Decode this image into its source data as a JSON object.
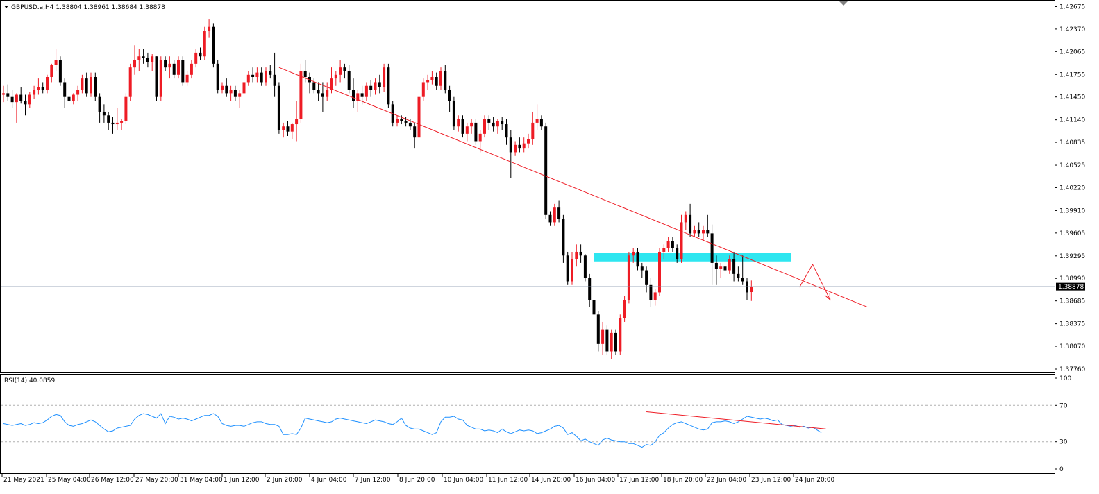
{
  "header": {
    "symbol_info": "GBPUSD.a,H4  1.38804 1.38961 1.38684 1.38878",
    "rsi_info": "RSI(14) 40.0859"
  },
  "current_price_label": "1.38878",
  "chart_data": {
    "type": "candlestick",
    "symbol": "GBPUSD.a",
    "timeframe": "H4",
    "ohlc_current": {
      "open": 1.38804,
      "high": 1.38961,
      "low": 1.38684,
      "close": 1.38878
    },
    "price_axis": {
      "ylim": [
        1.3776,
        1.4267
      ],
      "ticks": [
        "1.42675",
        "1.42370",
        "1.42065",
        "1.41755",
        "1.41450",
        "1.41140",
        "1.40835",
        "1.40525",
        "1.40220",
        "1.39910",
        "1.39605",
        "1.39295",
        "1.38990",
        "1.38685",
        "1.38375",
        "1.38070",
        "1.37760"
      ]
    },
    "x_ticks": [
      "21 May 2021",
      "25 May 04:00",
      "26 May 12:00",
      "27 May 20:00",
      "31 May 04:00",
      "1 Jun 12:00",
      "2 Jun 20:00",
      "4 Jun 04:00",
      "7 Jun 12:00",
      "8 Jun 20:00",
      "10 Jun 04:00",
      "11 Jun 12:00",
      "14 Jun 20:00",
      "16 Jun 04:00",
      "17 Jun 12:00",
      "18 Jun 20:00",
      "22 Jun 04:00",
      "23 Jun 12:00",
      "24 Jun 20:00"
    ],
    "candles": [
      [
        1.4148,
        1.416,
        1.4138,
        1.415
      ],
      [
        1.415,
        1.4162,
        1.414,
        1.4145
      ],
      [
        1.4145,
        1.4155,
        1.413,
        1.4138
      ],
      [
        1.4138,
        1.415,
        1.411,
        1.4148
      ],
      [
        1.4148,
        1.4158,
        1.4136,
        1.414
      ],
      [
        1.414,
        1.4148,
        1.412,
        1.4135
      ],
      [
        1.4135,
        1.4152,
        1.413,
        1.4148
      ],
      [
        1.4148,
        1.416,
        1.4142,
        1.4155
      ],
      [
        1.4155,
        1.417,
        1.4148,
        1.4158
      ],
      [
        1.4158,
        1.4165,
        1.415,
        1.4155
      ],
      [
        1.4155,
        1.4175,
        1.415,
        1.4172
      ],
      [
        1.4172,
        1.419,
        1.4165,
        1.4188
      ],
      [
        1.4188,
        1.421,
        1.418,
        1.4195
      ],
      [
        1.4195,
        1.42,
        1.416,
        1.4165
      ],
      [
        1.4165,
        1.417,
        1.413,
        1.4145
      ],
      [
        1.4145,
        1.4152,
        1.413,
        1.414
      ],
      [
        1.414,
        1.415,
        1.4135,
        1.4148
      ],
      [
        1.4148,
        1.416,
        1.414,
        1.4155
      ],
      [
        1.4155,
        1.4175,
        1.415,
        1.417
      ],
      [
        1.417,
        1.4178,
        1.4145,
        1.415
      ],
      [
        1.415,
        1.4178,
        1.4145,
        1.4172
      ],
      [
        1.4172,
        1.4178,
        1.414,
        1.4145
      ],
      [
        1.4145,
        1.415,
        1.411,
        1.4125
      ],
      [
        1.4125,
        1.4135,
        1.411,
        1.412
      ],
      [
        1.412,
        1.4125,
        1.41,
        1.411
      ],
      [
        1.411,
        1.4118,
        1.4095,
        1.4108
      ],
      [
        1.4108,
        1.413,
        1.41,
        1.411
      ],
      [
        1.411,
        1.4115,
        1.41,
        1.4112
      ],
      [
        1.4112,
        1.415,
        1.4108,
        1.4145
      ],
      [
        1.4145,
        1.419,
        1.414,
        1.4185
      ],
      [
        1.4185,
        1.4215,
        1.4175,
        1.4195
      ],
      [
        1.4195,
        1.421,
        1.418,
        1.42
      ],
      [
        1.42,
        1.421,
        1.419,
        1.4198
      ],
      [
        1.4198,
        1.4205,
        1.4185,
        1.4192
      ],
      [
        1.4192,
        1.4203,
        1.418,
        1.42
      ],
      [
        1.42,
        1.42,
        1.414,
        1.4145
      ],
      [
        1.4145,
        1.42,
        1.414,
        1.4195
      ],
      [
        1.4195,
        1.42,
        1.418,
        1.4185
      ],
      [
        1.4185,
        1.42,
        1.417,
        1.419
      ],
      [
        1.419,
        1.4195,
        1.417,
        1.4175
      ],
      [
        1.4175,
        1.42,
        1.417,
        1.4195
      ],
      [
        1.4195,
        1.42,
        1.416,
        1.4165
      ],
      [
        1.4165,
        1.418,
        1.416,
        1.4175
      ],
      [
        1.4175,
        1.4195,
        1.417,
        1.419
      ],
      [
        1.419,
        1.421,
        1.4185,
        1.4205
      ],
      [
        1.4205,
        1.4212,
        1.4195,
        1.42
      ],
      [
        1.42,
        1.424,
        1.4195,
        1.4235
      ],
      [
        1.4235,
        1.425,
        1.4225,
        1.424
      ],
      [
        1.424,
        1.4245,
        1.4185,
        1.419
      ],
      [
        1.419,
        1.4195,
        1.415,
        1.4155
      ],
      [
        1.4155,
        1.4165,
        1.415,
        1.416
      ],
      [
        1.416,
        1.417,
        1.4145,
        1.415
      ],
      [
        1.415,
        1.416,
        1.414,
        1.4155
      ],
      [
        1.4155,
        1.416,
        1.414,
        1.4145
      ],
      [
        1.4145,
        1.4155,
        1.413,
        1.415
      ],
      [
        1.415,
        1.4168,
        1.4112,
        1.4165
      ],
      [
        1.4165,
        1.418,
        1.416,
        1.4175
      ],
      [
        1.4175,
        1.4185,
        1.4165,
        1.4172
      ],
      [
        1.4172,
        1.4185,
        1.4165,
        1.4178
      ],
      [
        1.4178,
        1.4185,
        1.416,
        1.4165
      ],
      [
        1.4165,
        1.4185,
        1.416,
        1.418
      ],
      [
        1.418,
        1.4188,
        1.417,
        1.4175
      ],
      [
        1.4175,
        1.4205,
        1.4145,
        1.416
      ],
      [
        1.416,
        1.4165,
        1.4095,
        1.41
      ],
      [
        1.41,
        1.411,
        1.409,
        1.4105
      ],
      [
        1.4105,
        1.4112,
        1.4092,
        1.4098
      ],
      [
        1.4098,
        1.411,
        1.4088,
        1.4108
      ],
      [
        1.4108,
        1.414,
        1.4085,
        1.4115
      ],
      [
        1.4115,
        1.419,
        1.411,
        1.418
      ],
      [
        1.418,
        1.4195,
        1.4165,
        1.4172
      ],
      [
        1.4172,
        1.4178,
        1.415,
        1.4165
      ],
      [
        1.4165,
        1.417,
        1.415,
        1.4155
      ],
      [
        1.4155,
        1.4165,
        1.414,
        1.415
      ],
      [
        1.415,
        1.4165,
        1.4125,
        1.4145
      ],
      [
        1.4145,
        1.4165,
        1.414,
        1.4155
      ],
      [
        1.4155,
        1.4185,
        1.415,
        1.417
      ],
      [
        1.417,
        1.418,
        1.416,
        1.4175
      ],
      [
        1.4175,
        1.4195,
        1.4165,
        1.4185
      ],
      [
        1.4185,
        1.419,
        1.417,
        1.418
      ],
      [
        1.418,
        1.4188,
        1.415,
        1.4155
      ],
      [
        1.4155,
        1.417,
        1.413,
        1.414
      ],
      [
        1.414,
        1.4155,
        1.4125,
        1.415
      ],
      [
        1.415,
        1.416,
        1.4135,
        1.4145
      ],
      [
        1.4145,
        1.4165,
        1.414,
        1.416
      ],
      [
        1.416,
        1.4168,
        1.4145,
        1.4155
      ],
      [
        1.4155,
        1.417,
        1.4148,
        1.4165
      ],
      [
        1.4165,
        1.4175,
        1.415,
        1.4158
      ],
      [
        1.4158,
        1.419,
        1.4152,
        1.4185
      ],
      [
        1.4185,
        1.419,
        1.413,
        1.4135
      ],
      [
        1.4135,
        1.414,
        1.4105,
        1.411
      ],
      [
        1.411,
        1.412,
        1.4105,
        1.4115
      ],
      [
        1.4115,
        1.412,
        1.4108,
        1.4112
      ],
      [
        1.4112,
        1.4118,
        1.4105,
        1.411
      ],
      [
        1.411,
        1.4115,
        1.41,
        1.4105
      ],
      [
        1.4105,
        1.411,
        1.4075,
        1.409
      ],
      [
        1.409,
        1.415,
        1.4085,
        1.4145
      ],
      [
        1.4145,
        1.417,
        1.414,
        1.4165
      ],
      [
        1.4165,
        1.4175,
        1.4155,
        1.4168
      ],
      [
        1.4168,
        1.418,
        1.4162,
        1.4172
      ],
      [
        1.4172,
        1.4178,
        1.4155,
        1.416
      ],
      [
        1.416,
        1.4185,
        1.4155,
        1.418
      ],
      [
        1.418,
        1.4188,
        1.415,
        1.4155
      ],
      [
        1.4155,
        1.416,
        1.4125,
        1.414
      ],
      [
        1.414,
        1.4145,
        1.41,
        1.4105
      ],
      [
        1.4105,
        1.412,
        1.4098,
        1.4115
      ],
      [
        1.4115,
        1.412,
        1.409,
        1.4095
      ],
      [
        1.4095,
        1.411,
        1.4085,
        1.4105
      ],
      [
        1.4105,
        1.4115,
        1.4095,
        1.411
      ],
      [
        1.411,
        1.4115,
        1.408,
        1.4085
      ],
      [
        1.4085,
        1.41,
        1.407,
        1.4095
      ],
      [
        1.4095,
        1.412,
        1.409,
        1.4115
      ],
      [
        1.4115,
        1.412,
        1.41,
        1.411
      ],
      [
        1.411,
        1.4118,
        1.4098,
        1.4105
      ],
      [
        1.4105,
        1.4115,
        1.4095,
        1.4112
      ],
      [
        1.4112,
        1.4118,
        1.41,
        1.4108
      ],
      [
        1.4108,
        1.4115,
        1.408,
        1.409
      ],
      [
        1.409,
        1.41,
        1.4035,
        1.407
      ],
      [
        1.407,
        1.4085,
        1.4065,
        1.408
      ],
      [
        1.408,
        1.409,
        1.407,
        1.4075
      ],
      [
        1.4075,
        1.409,
        1.407,
        1.4082
      ],
      [
        1.4082,
        1.4095,
        1.4075,
        1.4088
      ],
      [
        1.4088,
        1.4125,
        1.408,
        1.411
      ],
      [
        1.411,
        1.4135,
        1.41,
        1.4115
      ],
      [
        1.4115,
        1.412,
        1.41,
        1.4105
      ],
      [
        1.4105,
        1.411,
        1.398,
        1.3985
      ],
      [
        1.3985,
        1.399,
        1.397,
        1.3975
      ],
      [
        1.3975,
        1.4,
        1.397,
        1.3995
      ],
      [
        1.3995,
        1.4005,
        1.3975,
        1.398
      ],
      [
        1.398,
        1.3985,
        1.392,
        1.393
      ],
      [
        1.393,
        1.3935,
        1.389,
        1.3895
      ],
      [
        1.3895,
        1.3935,
        1.389,
        1.3925
      ],
      [
        1.3925,
        1.3945,
        1.3915,
        1.3935
      ],
      [
        1.3935,
        1.3945,
        1.392,
        1.393
      ],
      [
        1.393,
        1.3932,
        1.3895,
        1.39
      ],
      [
        1.39,
        1.3905,
        1.386,
        1.387
      ],
      [
        1.387,
        1.3875,
        1.3845,
        1.385
      ],
      [
        1.385,
        1.3855,
        1.38,
        1.381
      ],
      [
        1.381,
        1.384,
        1.3795,
        1.383
      ],
      [
        1.383,
        1.3835,
        1.3795,
        1.38
      ],
      [
        1.38,
        1.383,
        1.379,
        1.3825
      ],
      [
        1.3825,
        1.383,
        1.3795,
        1.38
      ],
      [
        1.38,
        1.385,
        1.3795,
        1.3845
      ],
      [
        1.3845,
        1.3875,
        1.384,
        1.387
      ],
      [
        1.387,
        1.3935,
        1.3865,
        1.393
      ],
      [
        1.393,
        1.394,
        1.392,
        1.3935
      ],
      [
        1.3935,
        1.394,
        1.391,
        1.3915
      ],
      [
        1.3915,
        1.392,
        1.39,
        1.391
      ],
      [
        1.391,
        1.3915,
        1.388,
        1.389
      ],
      [
        1.389,
        1.39,
        1.386,
        1.387
      ],
      [
        1.387,
        1.3885,
        1.3862,
        1.388
      ],
      [
        1.388,
        1.394,
        1.3875,
        1.3935
      ],
      [
        1.3935,
        1.3945,
        1.3925,
        1.394
      ],
      [
        1.394,
        1.3955,
        1.3935,
        1.395
      ],
      [
        1.395,
        1.3955,
        1.3935,
        1.394
      ],
      [
        1.394,
        1.3945,
        1.392,
        1.3925
      ],
      [
        1.3925,
        1.3985,
        1.392,
        1.3975
      ],
      [
        1.3975,
        1.399,
        1.3965,
        1.3985
      ],
      [
        1.3985,
        1.4,
        1.3955,
        1.396
      ],
      [
        1.396,
        1.397,
        1.3955,
        1.3965
      ],
      [
        1.3965,
        1.3975,
        1.3955,
        1.396
      ],
      [
        1.396,
        1.397,
        1.395,
        1.3965
      ],
      [
        1.3965,
        1.3985,
        1.3955,
        1.396
      ],
      [
        1.396,
        1.3972,
        1.389,
        1.392
      ],
      [
        1.392,
        1.393,
        1.389,
        1.3912
      ],
      [
        1.3912,
        1.392,
        1.39,
        1.3915
      ],
      [
        1.3915,
        1.3925,
        1.3905,
        1.391
      ],
      [
        1.391,
        1.393,
        1.3905,
        1.3925
      ],
      [
        1.3925,
        1.3935,
        1.3895,
        1.3905
      ],
      [
        1.3905,
        1.3915,
        1.3895,
        1.39
      ],
      [
        1.39,
        1.393,
        1.389,
        1.3895
      ],
      [
        1.3895,
        1.39,
        1.387,
        1.388
      ],
      [
        1.38804,
        1.38961,
        1.38684,
        1.38878
      ]
    ],
    "trendline_price": {
      "from": [
        63,
        1.4185
      ],
      "to": [
        181,
        1.39
      ]
    },
    "resistance_zone": {
      "from_index": 135,
      "to_index": 180,
      "top": 1.3934,
      "bottom": 1.3922
    },
    "projection_arrow": [
      [
        182,
        1.3887
      ],
      [
        185,
        1.3918
      ],
      [
        189,
        1.387
      ]
    ],
    "rsi": {
      "period": 14,
      "current": 40.0859,
      "ylim": [
        0,
        100
      ],
      "ticks": [
        "100",
        "70",
        "30",
        "0"
      ],
      "levels": [
        70,
        30
      ],
      "values": [
        50,
        49,
        48,
        49,
        50,
        48,
        49,
        51,
        50,
        51,
        54,
        58,
        60,
        59,
        52,
        48,
        47,
        49,
        50,
        52,
        54,
        52,
        48,
        44,
        41,
        42,
        45,
        46,
        47,
        48,
        55,
        59,
        61,
        60,
        58,
        56,
        61,
        50,
        58,
        57,
        55,
        56,
        55,
        53,
        55,
        57,
        59,
        59,
        61,
        58,
        50,
        48,
        47,
        48,
        48,
        47,
        49,
        51,
        52,
        52,
        50,
        49,
        49,
        47,
        38,
        38,
        39,
        38,
        45,
        56,
        55,
        54,
        53,
        52,
        51,
        52,
        55,
        56,
        55,
        54,
        53,
        52,
        51,
        50,
        52,
        54,
        53,
        52,
        50,
        49,
        52,
        56,
        48,
        45,
        44,
        44,
        42,
        40,
        38,
        40,
        52,
        57,
        57,
        58,
        55,
        54,
        48,
        46,
        44,
        44,
        42,
        43,
        42,
        40,
        44,
        41,
        39,
        41,
        43,
        42,
        43,
        42,
        39,
        40,
        42,
        44,
        47,
        48,
        45,
        38,
        40,
        36,
        31,
        33,
        30,
        28,
        26,
        32,
        34,
        32,
        31,
        30,
        30,
        28,
        28,
        26,
        24,
        27,
        26,
        30,
        37,
        40,
        45,
        49,
        51,
        52,
        50,
        48,
        46,
        44,
        43,
        44,
        51,
        52,
        52,
        53,
        52,
        50,
        52,
        55,
        58,
        57,
        56,
        55,
        56,
        55,
        53,
        54,
        49,
        48,
        47,
        48,
        46,
        47,
        45,
        46,
        43,
        40
      ],
      "divergence_line": {
        "from": [
          147,
          63
        ],
        "to": [
          182,
          41
        ]
      }
    }
  }
}
